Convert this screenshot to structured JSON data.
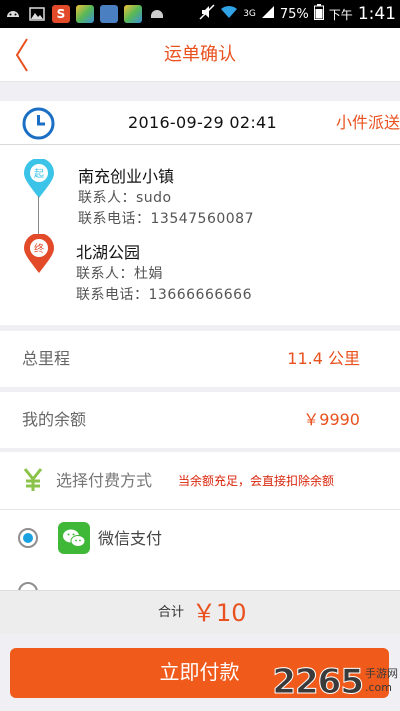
{
  "status_bar": {
    "battery": "75%",
    "ampm": "下午",
    "time": "1:41",
    "network": "3G"
  },
  "header": {
    "title": "运单确认"
  },
  "order": {
    "datetime": "2016-09-29 02:41",
    "tag": "小件派送"
  },
  "route": {
    "start_marker": "起",
    "end_marker": "终",
    "start": {
      "name": "南充创业小镇",
      "contact": "联系人：sudo",
      "phone": "联系电话：13547560087"
    },
    "end": {
      "name": "北湖公园",
      "contact": "联系人：杜娟",
      "phone": "联系电话：13666666666"
    }
  },
  "info": {
    "distance_label": "总里程",
    "distance_value": "11.4 公里",
    "balance_label": "我的余额",
    "balance_value": "￥9990"
  },
  "payment": {
    "header_label": "选择付费方式",
    "note": "当余额充足，会直接扣除余额",
    "methods": [
      {
        "label": "微信支付",
        "selected": true,
        "icon": "wechat-icon"
      }
    ]
  },
  "total": {
    "label": "合计",
    "value": "￥10"
  },
  "actions": {
    "pay_label": "立即付款"
  },
  "watermark": {
    "big": "2265",
    "small": "手游网",
    "small2": ".com"
  },
  "colors": {
    "accent": "#e9511f",
    "pay_button": "#f05a1b",
    "start_pin": "#3cc3e8",
    "end_pin": "#e24a2a",
    "radio_selected": "#1aa1e0"
  }
}
